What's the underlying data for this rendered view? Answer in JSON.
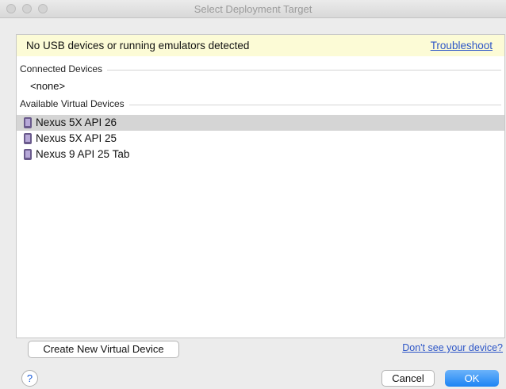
{
  "window": {
    "title": "Select Deployment Target"
  },
  "banner": {
    "message": "No USB devices or running emulators detected",
    "link": "Troubleshoot"
  },
  "connected": {
    "header": "Connected Devices",
    "empty": "<none>"
  },
  "available": {
    "header": "Available Virtual Devices",
    "devices": [
      {
        "label": "Nexus 5X API 26",
        "selected": true
      },
      {
        "label": "Nexus 5X API 25",
        "selected": false
      },
      {
        "label": "Nexus 9 API 25 Tab",
        "selected": false
      }
    ]
  },
  "footer": {
    "create_label": "Create New Virtual Device",
    "help_link": "Don't see your device?",
    "help_icon": "?",
    "cancel_label": "Cancel",
    "ok_label": "OK"
  },
  "colors": {
    "banner_bg": "#fcfbd6",
    "link": "#2d56c7",
    "selected_row": "#d5d5d5",
    "ok_button": "#1c84f4"
  }
}
